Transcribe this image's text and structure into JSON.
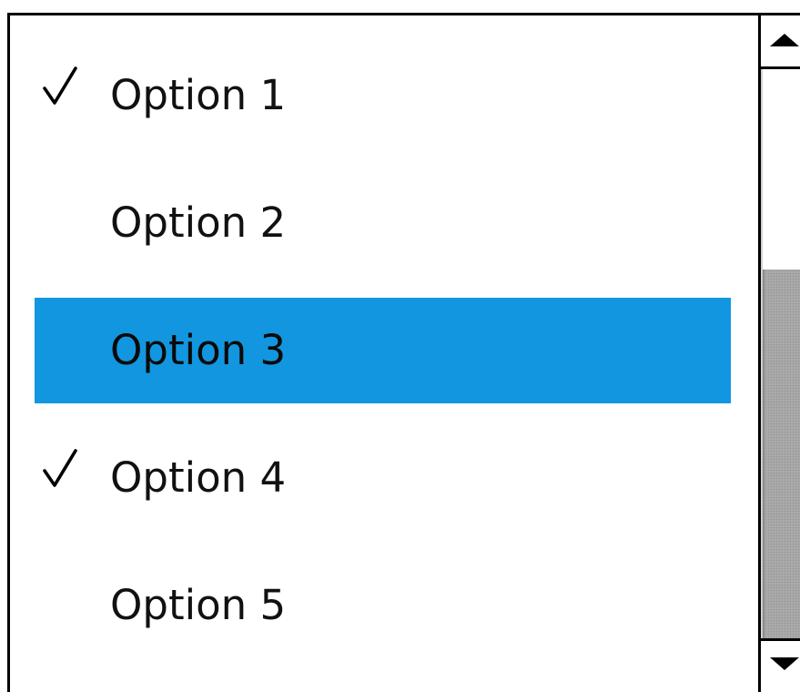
{
  "listbox": {
    "items": [
      {
        "label": "Option 1",
        "checked": true,
        "highlighted": false
      },
      {
        "label": "Option 2",
        "checked": false,
        "highlighted": false
      },
      {
        "label": "Option 3",
        "checked": false,
        "highlighted": true
      },
      {
        "label": "Option 4",
        "checked": true,
        "highlighted": false
      },
      {
        "label": "Option 5",
        "checked": false,
        "highlighted": false
      }
    ],
    "check_icon": "checkmark-icon",
    "highlight_color": "#1296df"
  },
  "scrollbar": {
    "up_icon": "triangle-up-icon",
    "down_icon": "triangle-down-icon",
    "thumb_start_fraction": 0.35,
    "thumb_end_fraction": 1.0
  }
}
